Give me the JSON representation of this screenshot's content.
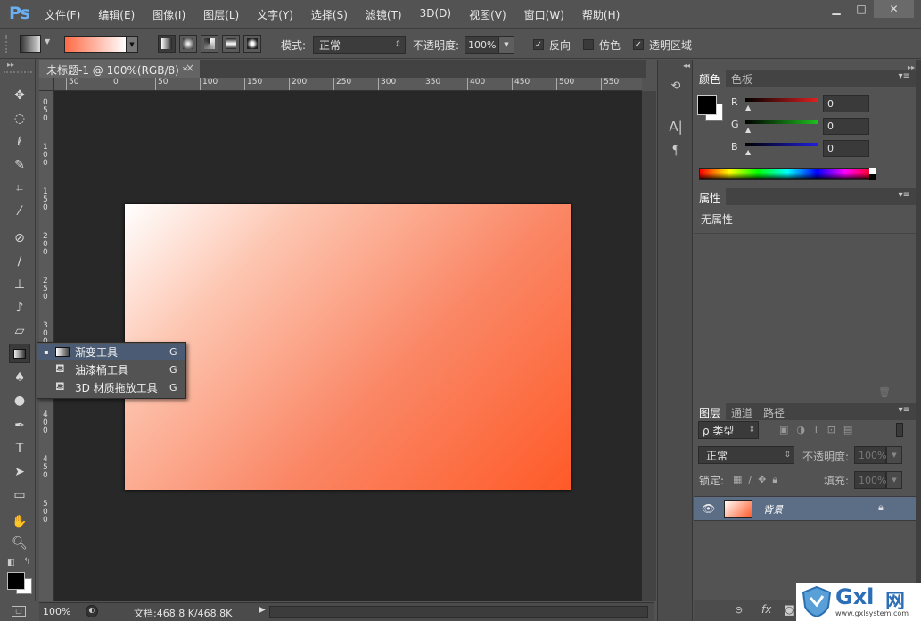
{
  "app": {
    "logo": "Ps"
  },
  "menu": [
    "文件(F)",
    "编辑(E)",
    "图像(I)",
    "图层(L)",
    "文字(Y)",
    "选择(S)",
    "滤镜(T)",
    "3D(D)",
    "视图(V)",
    "窗口(W)",
    "帮助(H)"
  ],
  "window_controls": {
    "minimize": "▁",
    "maximize": "□",
    "close": "✕"
  },
  "options": {
    "mode_label": "模式:",
    "mode_value": "正常",
    "opacity_label": "不透明度:",
    "opacity_value": "100%",
    "reverse_label": "反向",
    "reverse_checked": true,
    "dither_label": "仿色",
    "dither_checked": false,
    "transparency_label": "透明区域",
    "transparency_checked": true,
    "gradient_colors": [
      "#ff6a45",
      "#ffffff"
    ]
  },
  "document": {
    "tab_title": "未标题-1 @ 100%(RGB/8) *",
    "tab_close": "×",
    "ruler_h": [
      "50",
      "0",
      "50",
      "100",
      "150",
      "200",
      "250",
      "300",
      "350",
      "400",
      "450",
      "500",
      "550"
    ],
    "ruler_v": [
      "0",
      "5",
      "0",
      "1",
      "0",
      "0",
      "1",
      "5",
      "0",
      "2",
      "0",
      "0",
      "2",
      "5",
      "0",
      "3",
      "0",
      "0",
      "3",
      "5",
      "0",
      "4",
      "0",
      "0",
      "4",
      "5",
      "0",
      "5",
      "0",
      "0"
    ],
    "gradient_colors": [
      "#ffffff",
      "#fdc5b0",
      "#fa8766",
      "#ff5a28"
    ]
  },
  "flyout": {
    "items": [
      {
        "bullet": "▪",
        "label": "渐变工具",
        "key": "G"
      },
      {
        "bullet": "",
        "label": "油漆桶工具",
        "key": "G"
      },
      {
        "bullet": "",
        "label": "3D 材质拖放工具",
        "key": "G"
      }
    ]
  },
  "status": {
    "zoom": "100%",
    "doc": "文档:468.8 K/468.8K"
  },
  "panel_strip": {
    "icons": [
      "history-icon",
      "character-icon",
      "paragraph-icon"
    ]
  },
  "color_panel": {
    "tabs": [
      "颜色",
      "色板"
    ],
    "channels": [
      {
        "label": "R",
        "value": "0",
        "color": "#e02020"
      },
      {
        "label": "G",
        "value": "0",
        "color": "#20c020"
      },
      {
        "label": "B",
        "value": "0",
        "color": "#2020e0"
      }
    ]
  },
  "props_panel": {
    "tab": "属性",
    "text": "无属性"
  },
  "layers_panel": {
    "tabs": [
      "图层",
      "通道",
      "路径"
    ],
    "filter_label": "ρ 类型",
    "blend_value": "正常",
    "opacity_label": "不透明度:",
    "opacity_value": "100%",
    "lock_label": "锁定:",
    "fill_label": "填充:",
    "fill_value": "100%",
    "layer": {
      "name": "背景"
    },
    "bottom_fx": "fx"
  },
  "watermark": {
    "brand": "Gxl",
    "brand2": "网",
    "url": "www.gxlsystem.com"
  }
}
